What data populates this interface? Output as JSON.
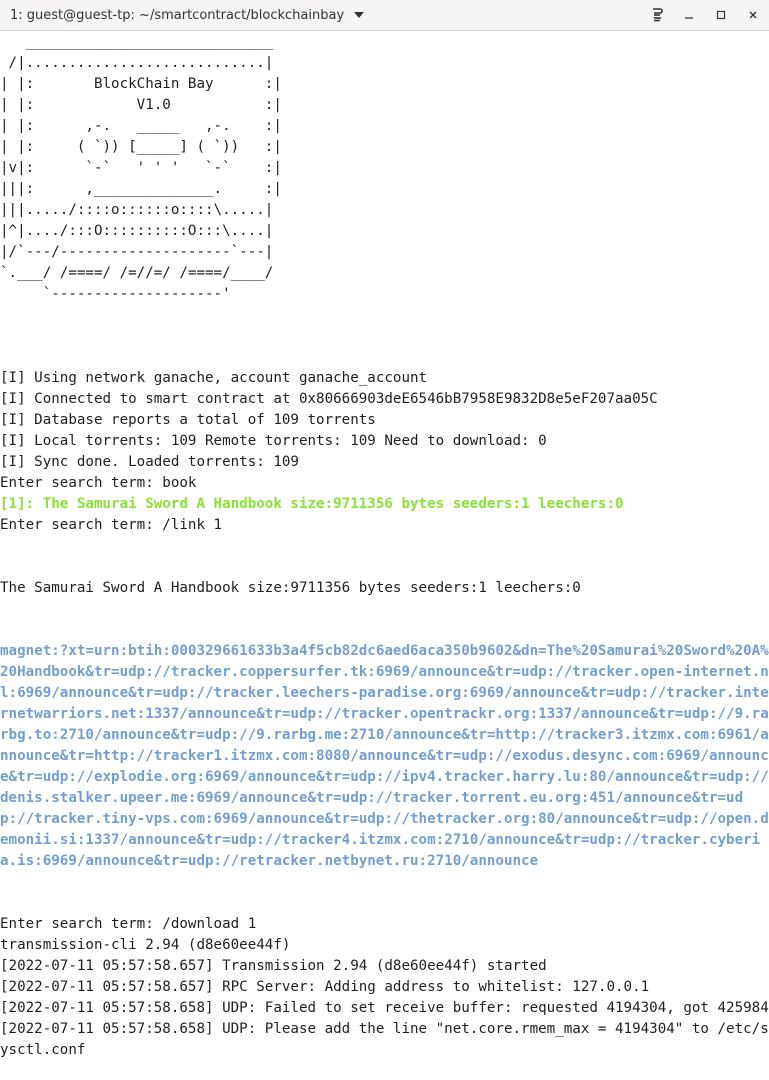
{
  "window": {
    "title": "1: guest@guest-tp: ~/smartcontract/blockchainbay"
  },
  "terminal": {
    "banner": [
      "   _____________________________",
      " /|............................|",
      "| |:       BlockChain Bay      :|",
      "| |:            V1.0           :|",
      "| |:      ,-.   _____   ,-.    :|",
      "| |:     ( `)) [_____] ( `))   :|",
      "|v|:      `-`   ' ' '   `-`    :|",
      "|||:      ,______________.     :|",
      "|||...../::::o::::::o::::\\.....|",
      "|^|..../:::O::::::::::O:::\\....|",
      "|/`---/--------------------`---|",
      "`.___/ /====/ /=//=/ /====/____/",
      "     `--------------------'"
    ],
    "info_lines": [
      "[I] Using network ganache, account ganache_account",
      "[I] Connected to smart contract at 0x80666903deE6546bB7958E9832D8e5eF207aa05C",
      "[I] Database reports a total of 109 torrents",
      "[I] Local torrents: 109 Remote torrents: 109 Need to download: 0",
      "[I] Sync done. Loaded torrents: 109"
    ],
    "search_1": "Enter search term: book",
    "result_1": "[1]: The Samurai Sword A Handbook size:9711356 bytes seeders:1 leechers:0",
    "search_2": "Enter search term: /link 1",
    "link_title": "The Samurai Sword A Handbook size:9711356 bytes seeders:1 leechers:0",
    "magnet": "magnet:?xt=urn:btih:000329661633b3a4f5cb82dc6aed6aca350b9602&dn=The%20Samurai%20Sword%20A%20Handbook&tr=udp://tracker.coppersurfer.tk:6969/announce&tr=udp://tracker.open-internet.nl:6969/announce&tr=udp://tracker.leechers-paradise.org:6969/announce&tr=udp://tracker.internetwarriors.net:1337/announce&tr=udp://tracker.opentrackr.org:1337/announce&tr=udp://9.rarbg.to:2710/announce&tr=udp://9.rarbg.me:2710/announce&tr=http://tracker3.itzmx.com:6961/announce&tr=http://tracker1.itzmx.com:8080/announce&tr=udp://exodus.desync.com:6969/announce&tr=udp://explodie.org:6969/announce&tr=udp://ipv4.tracker.harry.lu:80/announce&tr=udp://denis.stalker.upeer.me:6969/announce&tr=udp://tracker.torrent.eu.org:451/announce&tr=udp://tracker.tiny-vps.com:6969/announce&tr=udp://thetracker.org:80/announce&tr=udp://open.demonii.si:1337/announce&tr=udp://tracker4.itzmx.com:2710/announce&tr=udp://tracker.cyberia.is:6969/announce&tr=udp://retracker.netbynet.ru:2710/announce",
    "search_3": "Enter search term: /download 1",
    "download_lines": [
      "transmission-cli 2.94 (d8e60ee44f)",
      "[2022-07-11 05:57:58.657] Transmission 2.94 (d8e60ee44f) started",
      "[2022-07-11 05:57:58.657] RPC Server: Adding address to whitelist: 127.0.0.1",
      "[2022-07-11 05:57:58.658] UDP: Failed to set receive buffer: requested 4194304, got 425984",
      "[2022-07-11 05:57:58.658] UDP: Please add the line \"net.core.rmem_max = 4194304\" to /etc/sysctl.conf"
    ]
  },
  "icons": {
    "dropdown": "chevron-down-icon",
    "menu": "hamburger-icon",
    "minimize": "minimize-icon",
    "maximize": "maximize-icon",
    "close": "close-icon"
  },
  "colors": {
    "terminal_bg": "#ffffff",
    "terminal_fg": "#1f1f1f",
    "search_result": "#8ae234",
    "magnet_link": "#729fcf"
  }
}
